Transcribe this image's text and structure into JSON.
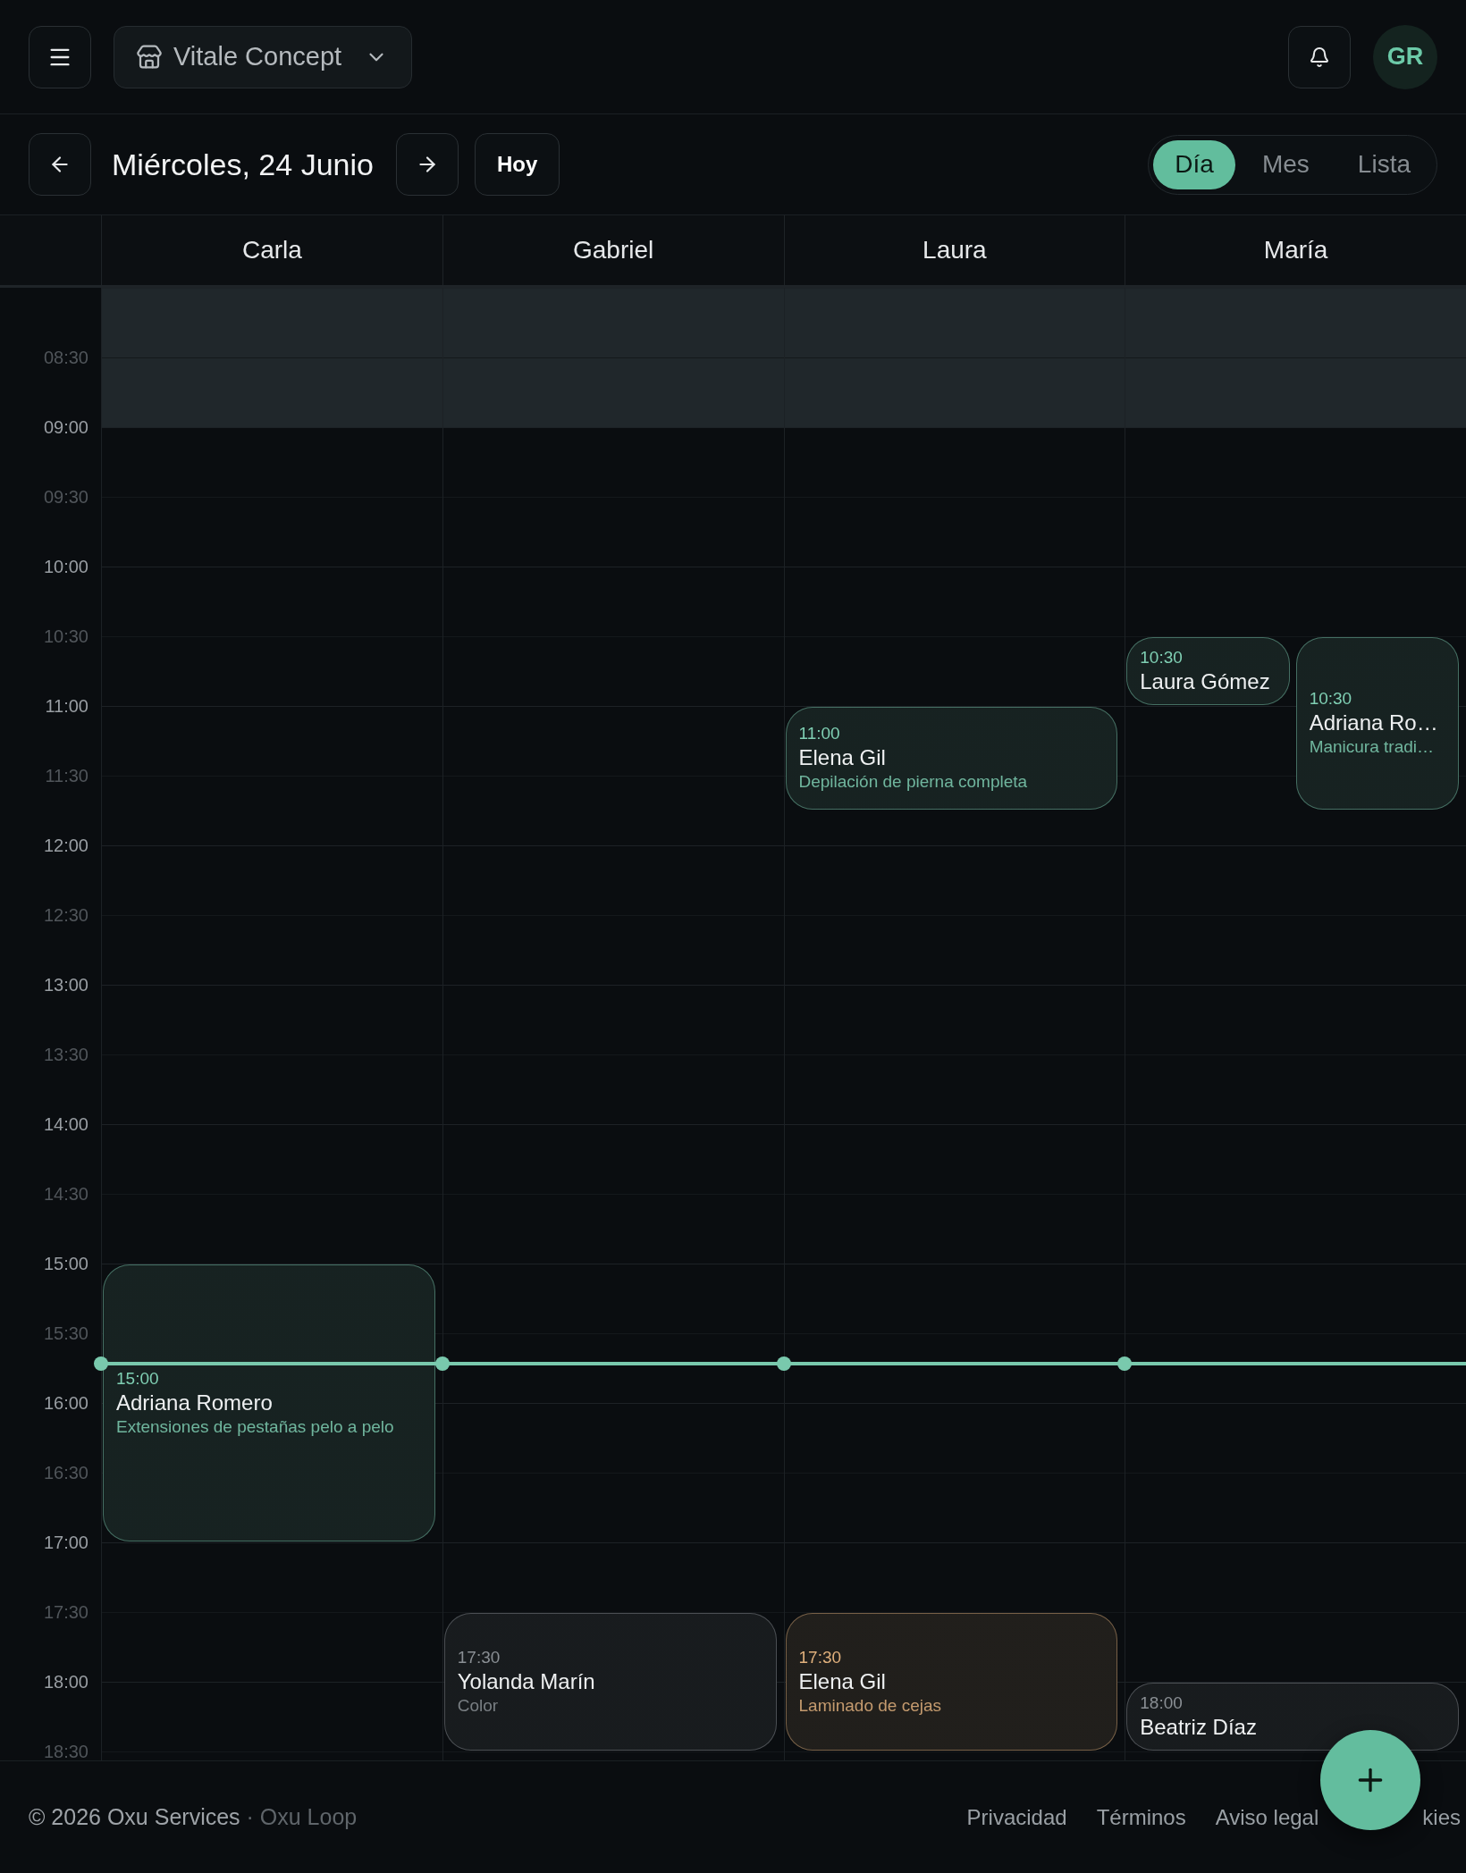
{
  "top_bar": {
    "business_name": "Vitale Concept",
    "avatar_initials": "GR"
  },
  "date_bar": {
    "date": "Miércoles, 24 Junio",
    "today_button": "Hoy",
    "views": [
      {
        "label": "Día",
        "selected": true
      },
      {
        "label": "Mes",
        "selected": false
      },
      {
        "label": "Lista",
        "selected": false
      }
    ]
  },
  "time_slots": [
    {
      "kind": "hour",
      "off_hours": true
    },
    {
      "label": "08:30",
      "kind": "half",
      "off_hours": true
    },
    {
      "label": "09:00",
      "kind": "hour",
      "off_hours": false
    },
    {
      "label": "09:30",
      "kind": "half",
      "off_hours": false
    },
    {
      "label": "10:00",
      "kind": "hour",
      "off_hours": false
    },
    {
      "label": "10:30",
      "kind": "half",
      "off_hours": false
    },
    {
      "label": "11:00",
      "kind": "hour",
      "off_hours": false
    },
    {
      "label": "11:30",
      "kind": "half",
      "off_hours": false
    },
    {
      "label": "12:00",
      "kind": "hour",
      "off_hours": false
    },
    {
      "label": "12:30",
      "kind": "half",
      "off_hours": false
    },
    {
      "label": "13:00",
      "kind": "hour",
      "off_hours": false
    },
    {
      "label": "13:30",
      "kind": "half",
      "off_hours": false
    },
    {
      "label": "14:00",
      "kind": "hour",
      "off_hours": false
    },
    {
      "label": "14:30",
      "kind": "half",
      "off_hours": false
    },
    {
      "label": "15:00",
      "kind": "hour",
      "off_hours": false
    },
    {
      "label": "15:30",
      "kind": "half",
      "off_hours": false
    },
    {
      "label": "16:00",
      "kind": "hour",
      "off_hours": false
    },
    {
      "label": "16:30",
      "kind": "half",
      "off_hours": false
    },
    {
      "label": "17:00",
      "kind": "hour",
      "off_hours": false
    },
    {
      "label": "17:30",
      "kind": "half",
      "off_hours": false
    },
    {
      "label": "18:00",
      "kind": "hour",
      "off_hours": false
    },
    {
      "label": "18:30",
      "kind": "half",
      "off_hours": false
    }
  ],
  "staff": [
    {
      "name": "Carla",
      "appointments": [
        {
          "time": "15:00",
          "client": "Adriana Romero",
          "service": "Extensiones de pestañas pelo a pelo",
          "color": "#7fcfb3"
        }
      ]
    },
    {
      "name": "Gabriel",
      "appointments": [
        {
          "time": "17:30",
          "client": "Yolanda Marín",
          "service": "Color",
          "color": "#8a8f94"
        }
      ]
    },
    {
      "name": "Laura",
      "appointments": [
        {
          "time": "11:00",
          "client": "Elena Gil",
          "service": "Depilación de pierna completa",
          "color": "#7fcfb3"
        },
        {
          "time": "17:30",
          "client": "Elena Gil",
          "service": "Laminado de cejas",
          "color": "#e0b07c"
        }
      ]
    },
    {
      "name": "María",
      "appointments": [
        {
          "time": "10:30",
          "client": "Laura Gómez",
          "color": "#7fcfb3"
        },
        {
          "time": "10:30",
          "client": "Adriana Ro…",
          "service": "Manicura tradi…",
          "color": "#7fcfb3"
        },
        {
          "time": "18:00",
          "client": "Beatriz Díaz",
          "color": "#8a8f94"
        }
      ]
    }
  ],
  "footer": {
    "copyright": "© 2026 Oxu Services",
    "product": "· Oxu Loop",
    "links": [
      "Privacidad",
      "Términos",
      "Aviso legal",
      "kies"
    ]
  }
}
